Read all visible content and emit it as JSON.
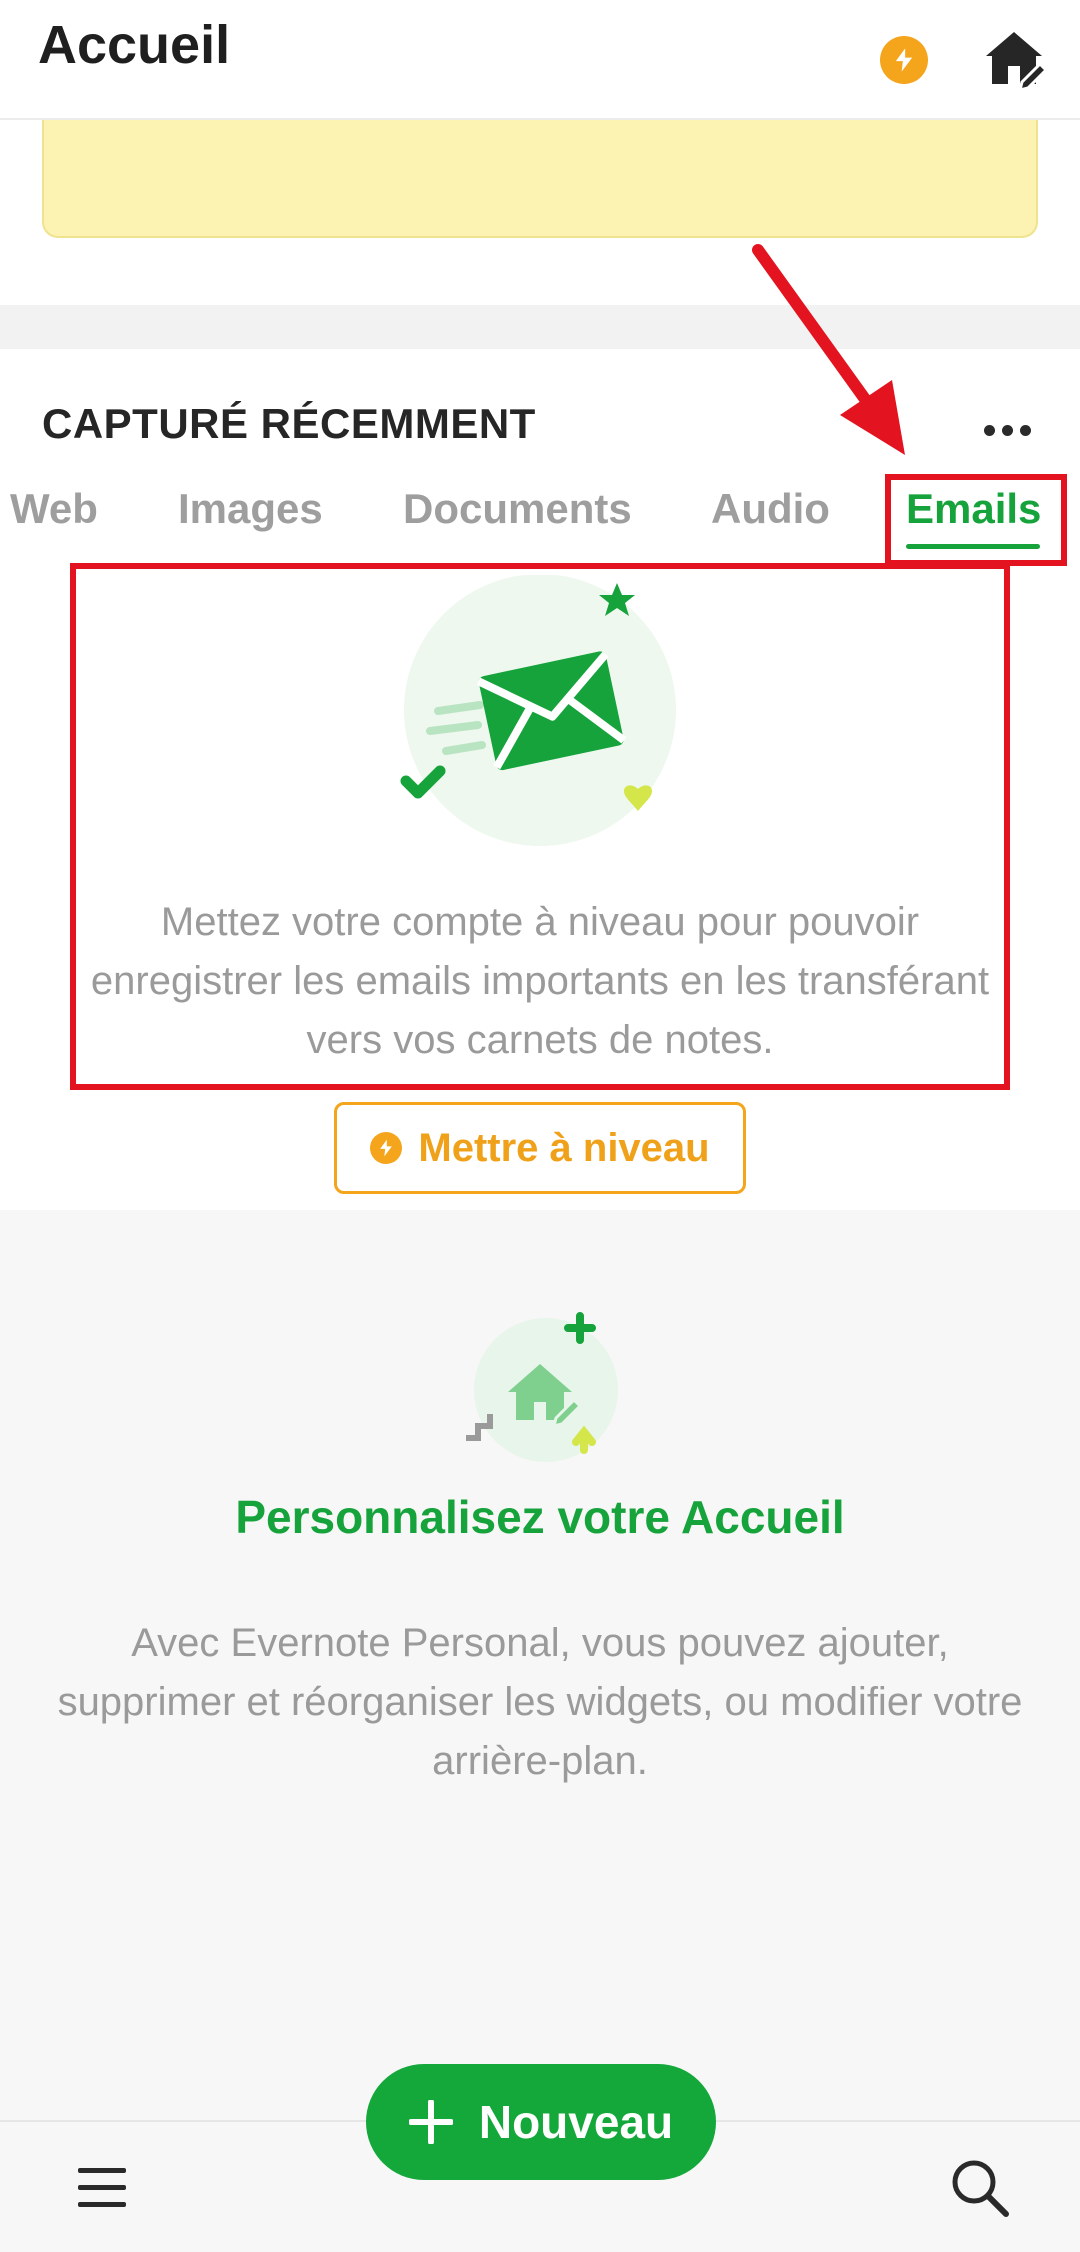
{
  "header": {
    "title": "Accueil",
    "icons": [
      "lightning-icon",
      "home-edit-icon"
    ]
  },
  "section": {
    "title": "CAPTURÉ RÉCEMMENT",
    "more_icon": "more-horizontal-icon"
  },
  "tabs": [
    {
      "label": "Web",
      "active": false
    },
    {
      "label": "Images",
      "active": false
    },
    {
      "label": "Documents",
      "active": false
    },
    {
      "label": "Audio",
      "active": false
    },
    {
      "label": "Emails",
      "active": true
    }
  ],
  "emails_empty": {
    "illustration_icon": "envelope-icon",
    "message": "Mettez votre compte à niveau pour pouvoir enregistrer les emails importants en les transférant vers vos carnets de notes.",
    "upgrade_label": "Mettre à niveau"
  },
  "personalize": {
    "title": "Personnalisez votre Accueil",
    "text": "Avec Evernote Personal, vous pouvez ajouter, supprimer et réorganiser les widgets, ou modifier votre arrière-plan."
  },
  "bottom_bar": {
    "new_label": "Nouveau",
    "icons": [
      "menu-icon",
      "search-icon",
      "plus-icon"
    ]
  },
  "colors": {
    "brand_green": "#16a33b",
    "upgrade_orange": "#f4a51c",
    "annotation_red": "#e3141f",
    "note_yellow": "#fcf3b2"
  }
}
